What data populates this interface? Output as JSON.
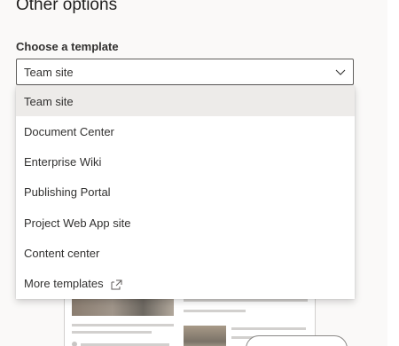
{
  "section": {
    "title": "Other options",
    "template_label": "Choose a template",
    "template_value": "Team site"
  },
  "dropdown": {
    "options": [
      {
        "label": "Team site",
        "selected": true
      },
      {
        "label": "Document Center",
        "selected": false
      },
      {
        "label": "Enterprise Wiki",
        "selected": false
      },
      {
        "label": "Publishing Portal",
        "selected": false
      },
      {
        "label": "Project Web App site",
        "selected": false
      },
      {
        "label": "Content center",
        "selected": false
      },
      {
        "label": "More templates",
        "selected": false,
        "icon": "external-link-icon"
      }
    ]
  },
  "colors": {
    "panel_background": "#faf9f8",
    "selected_option": "#edebe9",
    "border": "#605e5c",
    "text": "#323130"
  }
}
